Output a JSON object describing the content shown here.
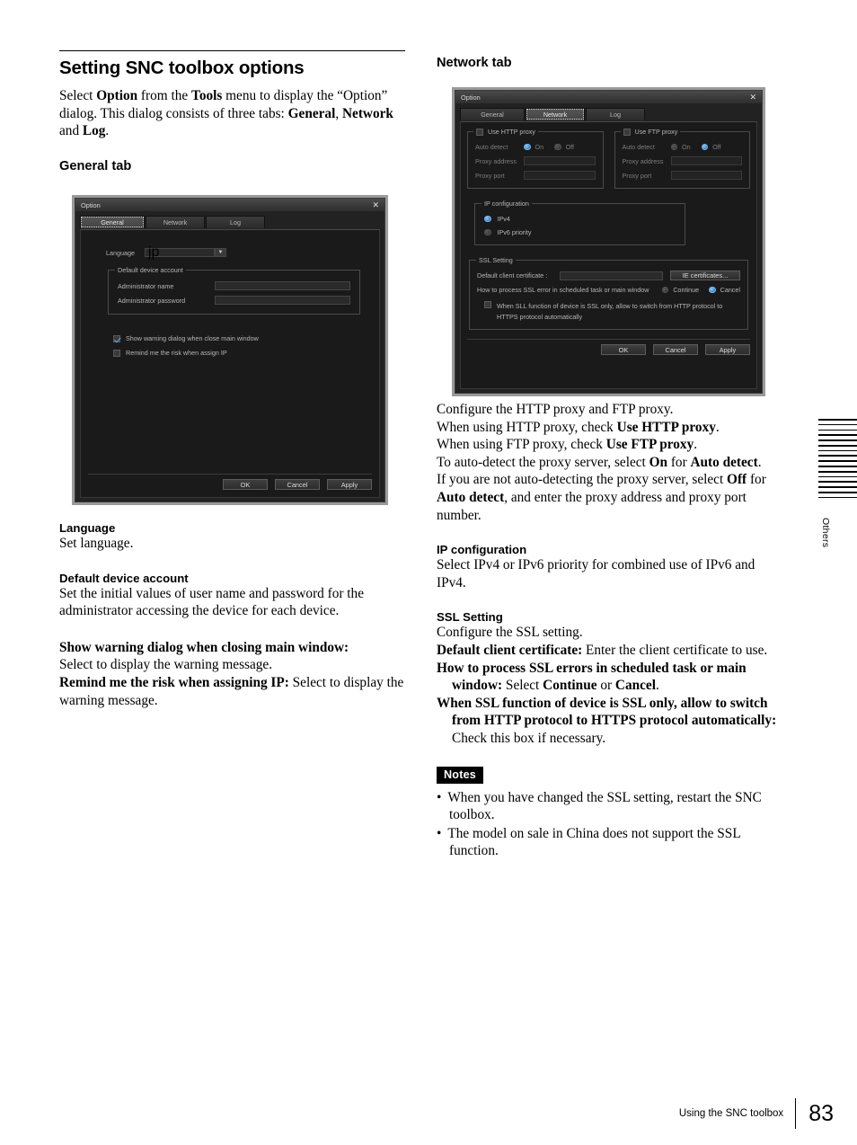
{
  "page": {
    "footer_text": "Using the SNC toolbox",
    "page_number": "83",
    "thumb_index_label": "Others",
    "thumb_bar_count": 16
  },
  "left": {
    "title": "Setting SNC toolbox options",
    "intro": {
      "p1a": "Select ",
      "p1b": "Option",
      "p1c": " from the ",
      "p1d": "Tools",
      "p1e": " menu to display the “Option” dialog. This dialog consists of three tabs: ",
      "p1f": "General",
      "p1g": ", ",
      "p1h": "Network",
      "p1i": " and ",
      "p1j": "Log",
      "p1k": "."
    },
    "general_tab_heading": "General tab",
    "sections": [
      {
        "heading": "Language",
        "body": "Set language."
      },
      {
        "heading": "Default device account",
        "body": "Set the initial values of user name and password for the administrator accessing the device for each device."
      }
    ],
    "defs": [
      {
        "term": "Show warning dialog when closing main window:",
        "desc": " Select to display the warning message."
      },
      {
        "term": "Remind me the risk when assigning IP:",
        "desc": " Select to display the warning message."
      }
    ]
  },
  "right": {
    "network_tab_heading": "Network tab",
    "proxy_paragraph": {
      "l1": "Configure the HTTP proxy and FTP proxy.",
      "l2a": "When using HTTP proxy, check ",
      "l2b": "Use HTTP proxy",
      "l2c": ".",
      "l3a": "When using FTP proxy, check ",
      "l3b": "Use FTP proxy",
      "l3c": ".",
      "l4a": "To auto-detect the proxy server, select ",
      "l4b": "On",
      "l4c": " for ",
      "l4d": "Auto detect",
      "l4e": ".",
      "l5a": "If you are not auto-detecting the proxy server, select ",
      "l5b": "Off",
      "l5c": " for ",
      "l5d": "Auto detect",
      "l5e": ", and enter the proxy address and proxy port number."
    },
    "ip_config": {
      "heading": "IP configuration",
      "body": "Select IPv4 or IPv6 priority for combined use of IPv6 and IPv4."
    },
    "ssl": {
      "heading": "SSL Setting",
      "body": "Configure the SSL setting.",
      "defs": [
        {
          "term": "Default client certificate:",
          "desc": " Enter the client certificate to use."
        },
        {
          "term": "How to process SSL errors in scheduled task or main window:",
          "desc_a": " Select ",
          "desc_b": "Continue",
          "desc_c": " or ",
          "desc_d": "Cancel",
          "desc_e": "."
        },
        {
          "term": "When SSL function of device is SSL only, allow to switch from HTTP protocol to HTTPS protocol automatically:",
          "desc": " Check this box if necessary."
        }
      ]
    },
    "notes": {
      "label": "Notes",
      "items": [
        "When you have changed the SSL setting, restart the SNC toolbox.",
        "The model on sale in China does not support the SSL function."
      ]
    }
  },
  "general_dialog": {
    "title": "Option",
    "close_icon": "✕",
    "tabs": [
      {
        "label": "General",
        "selected": true
      },
      {
        "label": "Network",
        "selected": false
      },
      {
        "label": "Log",
        "selected": false
      }
    ],
    "language_label": "Language",
    "language_value": "jp",
    "dropdown_arrow": "▼",
    "account_group_title": "Default device account",
    "admin_name_label": "Administrator name",
    "admin_name_value": "",
    "admin_password_label": "Administrator password",
    "admin_password_value": "",
    "checkbox_show_warning": {
      "label": "Show warning dialog when close main window",
      "checked": true
    },
    "checkbox_remind_risk": {
      "label": "Remind me the risk when assign IP",
      "checked": false
    },
    "buttons": {
      "ok": "OK",
      "cancel": "Cancel",
      "apply": "Apply"
    }
  },
  "network_dialog": {
    "title": "Option",
    "close_icon": "✕",
    "tabs": [
      {
        "label": "General",
        "selected": false
      },
      {
        "label": "Network",
        "selected": true
      },
      {
        "label": "Log",
        "selected": false
      }
    ],
    "http_proxy": {
      "checkbox_label": "Use HTTP proxy",
      "checked": false,
      "auto_detect_label": "Auto detect",
      "on_label": "On",
      "off_label": "Off",
      "selected": "On",
      "address_label": "Proxy address",
      "address_value": "",
      "port_label": "Proxy port",
      "port_value": ""
    },
    "ftp_proxy": {
      "checkbox_label": "Use FTP proxy",
      "checked": false,
      "auto_detect_label": "Auto detect",
      "on_label": "On",
      "off_label": "Off",
      "selected": "Off",
      "address_label": "Proxy address",
      "address_value": "",
      "port_label": "Proxy port",
      "port_value": ""
    },
    "ip_configuration": {
      "group_title": "IP configuration",
      "options": [
        {
          "label": "IPv4",
          "selected": true
        },
        {
          "label": "IPv6 priority",
          "selected": false
        }
      ]
    },
    "ssl_setting": {
      "group_title": "SSL Setting",
      "cert_label": "Default client certificate :",
      "cert_value": "",
      "ie_button": "IE certificates...",
      "error_label": "How to process SSL error in scheduled task or main window",
      "continue_label": "Continue",
      "cancel_label": "Cancel",
      "selected": "Cancel",
      "auto_switch_checkbox": {
        "line1": "When SLL function of device is SSL only, allow to switch from HTTP protocol to",
        "line2": "HTTPS protocol automatically",
        "checked": false
      }
    },
    "buttons": {
      "ok": "OK",
      "cancel": "Cancel",
      "apply": "Apply"
    }
  },
  "colors": {
    "accent_blue": "#3c8fd6",
    "dialog_bg": "#222222",
    "panel_bg": "#1a1a1a"
  }
}
